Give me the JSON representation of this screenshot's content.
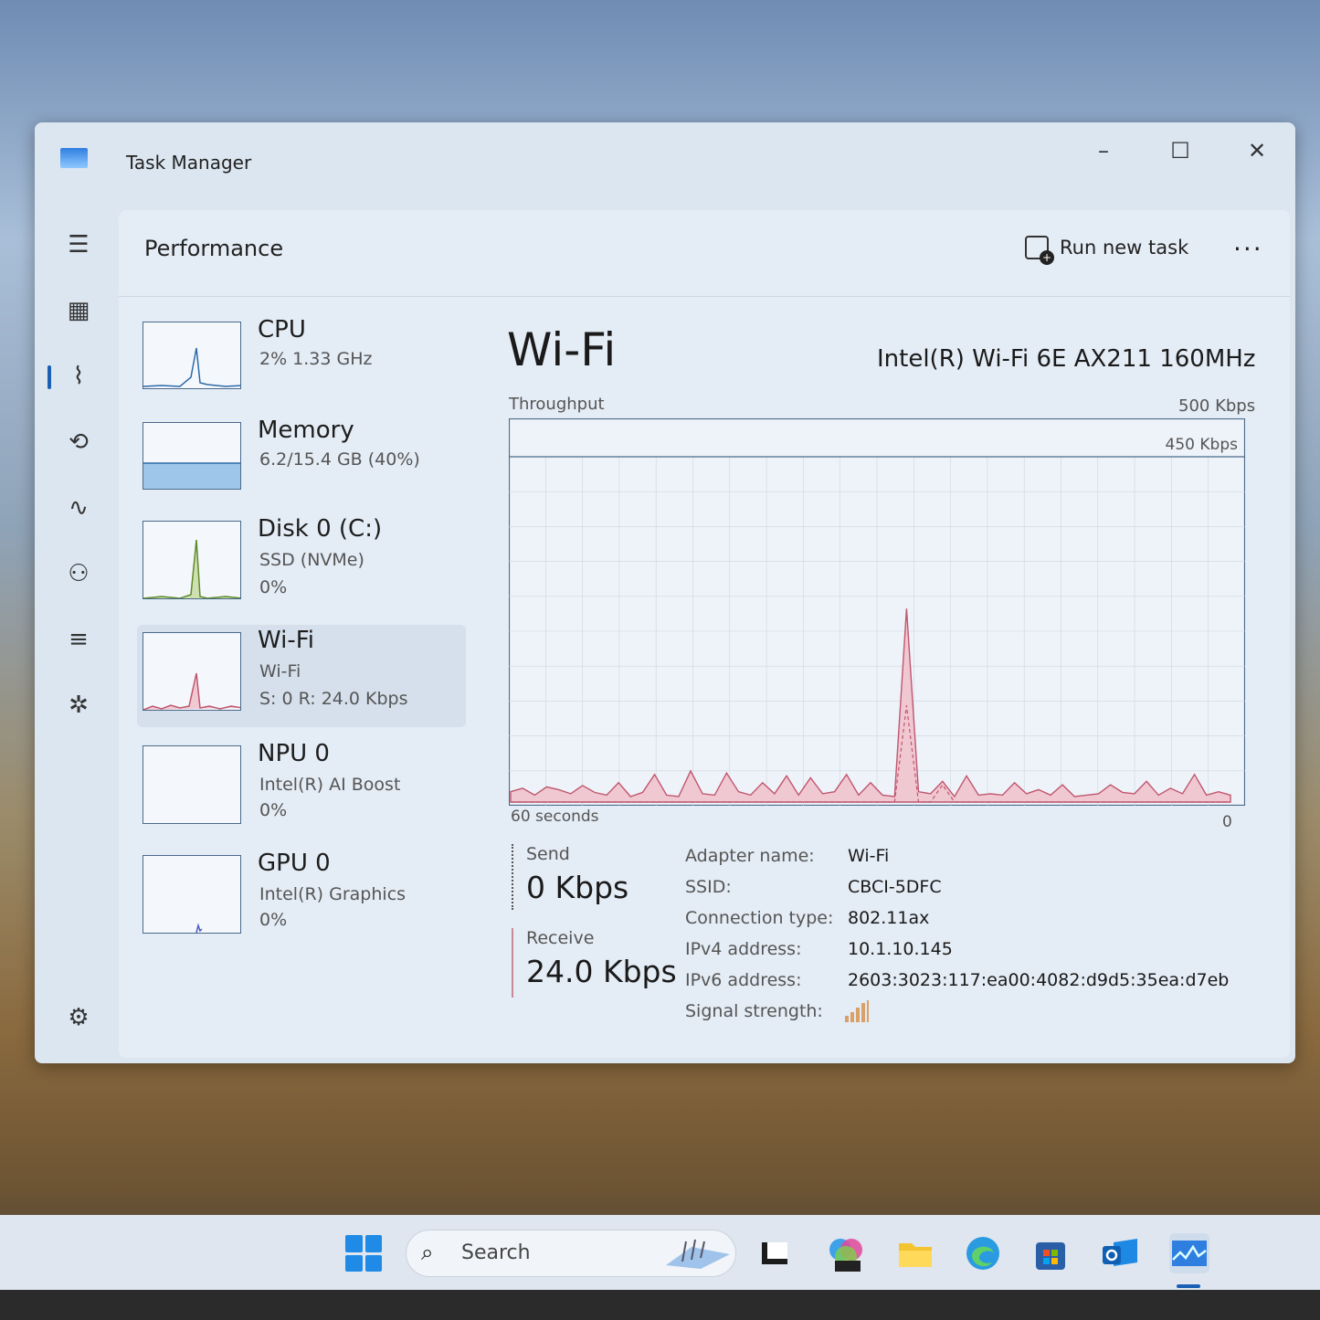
{
  "window": {
    "title": "Task Manager",
    "controls": {
      "minimize": "–",
      "maximize": "☐",
      "close": "✕"
    }
  },
  "nav": {
    "items": [
      {
        "name": "hamburger",
        "icon": "menu-icon",
        "glyph": "☰"
      },
      {
        "name": "processes",
        "icon": "processes-icon",
        "glyph": "▦"
      },
      {
        "name": "performance",
        "icon": "performance-icon",
        "glyph": "⌇",
        "active": true
      },
      {
        "name": "app-history",
        "icon": "history-icon",
        "glyph": "⟲"
      },
      {
        "name": "startup-apps",
        "icon": "startup-icon",
        "glyph": "∿"
      },
      {
        "name": "users",
        "icon": "users-icon",
        "glyph": "⚇"
      },
      {
        "name": "details",
        "icon": "details-icon",
        "glyph": "≡"
      },
      {
        "name": "services",
        "icon": "services-icon",
        "glyph": "✲"
      }
    ],
    "settings_glyph": "⚙"
  },
  "header": {
    "title": "Performance",
    "run_new_task": "Run new task",
    "more": "···"
  },
  "resources": [
    {
      "id": "cpu",
      "name": "CPU",
      "line1": "2%  1.33 GHz",
      "line2": ""
    },
    {
      "id": "memory",
      "name": "Memory",
      "line1": "6.2/15.4 GB (40%)",
      "line2": ""
    },
    {
      "id": "disk",
      "name": "Disk 0 (C:)",
      "line1": "SSD (NVMe)",
      "line2": "0%"
    },
    {
      "id": "wifi",
      "name": "Wi-Fi",
      "line1": "Wi-Fi",
      "line2": "S: 0  R: 24.0 Kbps",
      "selected": true
    },
    {
      "id": "npu",
      "name": "NPU 0",
      "line1": "Intel(R) AI Boost",
      "line2": "0%"
    },
    {
      "id": "gpu",
      "name": "GPU 0",
      "line1": "Intel(R) Graphics",
      "line2": "0%"
    }
  ],
  "detail": {
    "title": "Wi-Fi",
    "adapter_model": "Intel(R) Wi-Fi 6E AX211 160MHz",
    "throughput_label": "Throughput",
    "max_label": "500 Kbps",
    "scale_label": "450 Kbps",
    "time_left": "60 seconds",
    "time_right": "0",
    "send_label": "Send",
    "send_value": "0 Kbps",
    "receive_label": "Receive",
    "receive_value": "24.0 Kbps",
    "properties": [
      {
        "key": "Adapter name:",
        "value": "Wi-Fi"
      },
      {
        "key": "SSID:",
        "value": "CBCI-5DFC"
      },
      {
        "key": "Connection type:",
        "value": "802.11ax"
      },
      {
        "key": "IPv4 address:",
        "value": "10.1.10.145"
      },
      {
        "key": "IPv6 address:",
        "value": "2603:3023:117:ea00:4082:d9d5:35ea:d7eb"
      },
      {
        "key": "Signal strength:",
        "value": ""
      }
    ]
  },
  "chart_data": {
    "type": "area",
    "title": "",
    "xlabel": "",
    "ylabel": "Throughput",
    "x_range": [
      60,
      0
    ],
    "ylim": [
      0,
      500
    ],
    "x": [
      60,
      59,
      58,
      57,
      56,
      55,
      54,
      53,
      52,
      51,
      50,
      49,
      48,
      47,
      46,
      45,
      44,
      43,
      42,
      41,
      40,
      39,
      38,
      37,
      36,
      35,
      34,
      33,
      32,
      31,
      30,
      29,
      28,
      27,
      26,
      25,
      24,
      23,
      22,
      21,
      20,
      19,
      18,
      17,
      16,
      15,
      14,
      13,
      12,
      11,
      10,
      9,
      8,
      7,
      6,
      5,
      4,
      3,
      2,
      1,
      0
    ],
    "series": [
      {
        "name": "Receive",
        "values": [
          15,
          20,
          10,
          22,
          18,
          12,
          24,
          14,
          10,
          28,
          8,
          14,
          40,
          10,
          8,
          45,
          12,
          10,
          42,
          15,
          10,
          28,
          12,
          38,
          10,
          35,
          12,
          15,
          40,
          10,
          28,
          10,
          8,
          280,
          15,
          12,
          30,
          8,
          38,
          10,
          12,
          10,
          28,
          12,
          18,
          10,
          25,
          8,
          10,
          12,
          25,
          14,
          12,
          30,
          10,
          20,
          12,
          40,
          10,
          15,
          10
        ]
      },
      {
        "name": "Send",
        "values": [
          0,
          0,
          0,
          0,
          0,
          0,
          0,
          0,
          0,
          0,
          0,
          0,
          0,
          0,
          0,
          0,
          0,
          0,
          0,
          0,
          0,
          0,
          0,
          0,
          0,
          0,
          0,
          0,
          0,
          0,
          0,
          0,
          0,
          140,
          0,
          0,
          25,
          0,
          0,
          0,
          0,
          0,
          0,
          0,
          0,
          0,
          0,
          0,
          0,
          0,
          0,
          0,
          0,
          0,
          0,
          0,
          0,
          0,
          0,
          0,
          0
        ]
      }
    ],
    "grid": true
  },
  "taskbar": {
    "search_placeholder": "Search",
    "apps": [
      {
        "name": "terminal",
        "icon": "terminal-icon"
      },
      {
        "name": "m365",
        "icon": "m365-icon",
        "label": "M365"
      },
      {
        "name": "file-explorer",
        "icon": "folder-icon"
      },
      {
        "name": "edge",
        "icon": "edge-icon"
      },
      {
        "name": "store",
        "icon": "store-icon"
      },
      {
        "name": "outlook",
        "icon": "outlook-icon"
      },
      {
        "name": "task-manager",
        "icon": "task-manager-icon",
        "active": true
      }
    ]
  },
  "colors": {
    "accent": "#1a5fb4",
    "receive_line": "#c0566e",
    "receive_fill": "#f0c8d2",
    "grid": "#c9d6e2"
  }
}
